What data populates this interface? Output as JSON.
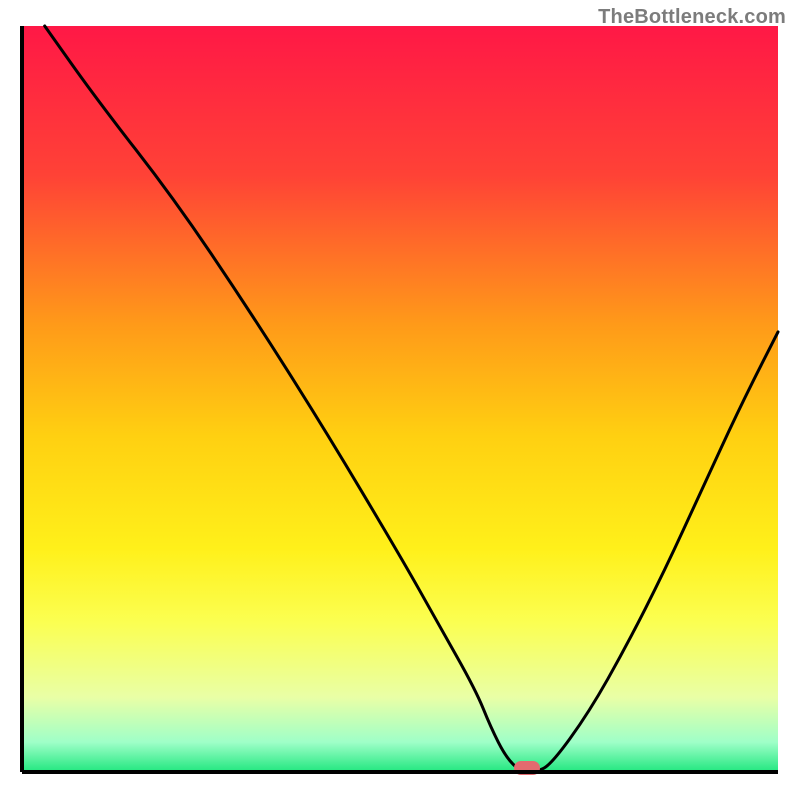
{
  "watermark": "TheBottleneck.com",
  "chart_data": {
    "type": "line",
    "title": "",
    "xlabel": "",
    "ylabel": "",
    "xlim": [
      0,
      100
    ],
    "ylim": [
      0,
      100
    ],
    "x": [
      3,
      10,
      20,
      30,
      40,
      50,
      55,
      60,
      62,
      64,
      66,
      68,
      70,
      75,
      80,
      85,
      90,
      95,
      100
    ],
    "values": [
      100,
      90,
      77,
      62,
      46,
      29,
      20,
      11,
      6,
      2,
      0,
      0,
      1,
      8,
      17,
      27,
      38,
      49,
      59
    ],
    "minimum_marker": {
      "x": 66.8,
      "y": 0.0
    },
    "background_gradient": {
      "stops": [
        {
          "offset": 0.0,
          "color": "#ff1846"
        },
        {
          "offset": 0.2,
          "color": "#ff4236"
        },
        {
          "offset": 0.4,
          "color": "#ff9a19"
        },
        {
          "offset": 0.55,
          "color": "#ffd011"
        },
        {
          "offset": 0.7,
          "color": "#fff01a"
        },
        {
          "offset": 0.8,
          "color": "#fbff52"
        },
        {
          "offset": 0.9,
          "color": "#e9ffa6"
        },
        {
          "offset": 0.96,
          "color": "#9fffc8"
        },
        {
          "offset": 1.0,
          "color": "#21e77f"
        }
      ]
    },
    "marker_color": "#e36a6f",
    "curve_color": "#000000",
    "axis_color": "#000000"
  }
}
